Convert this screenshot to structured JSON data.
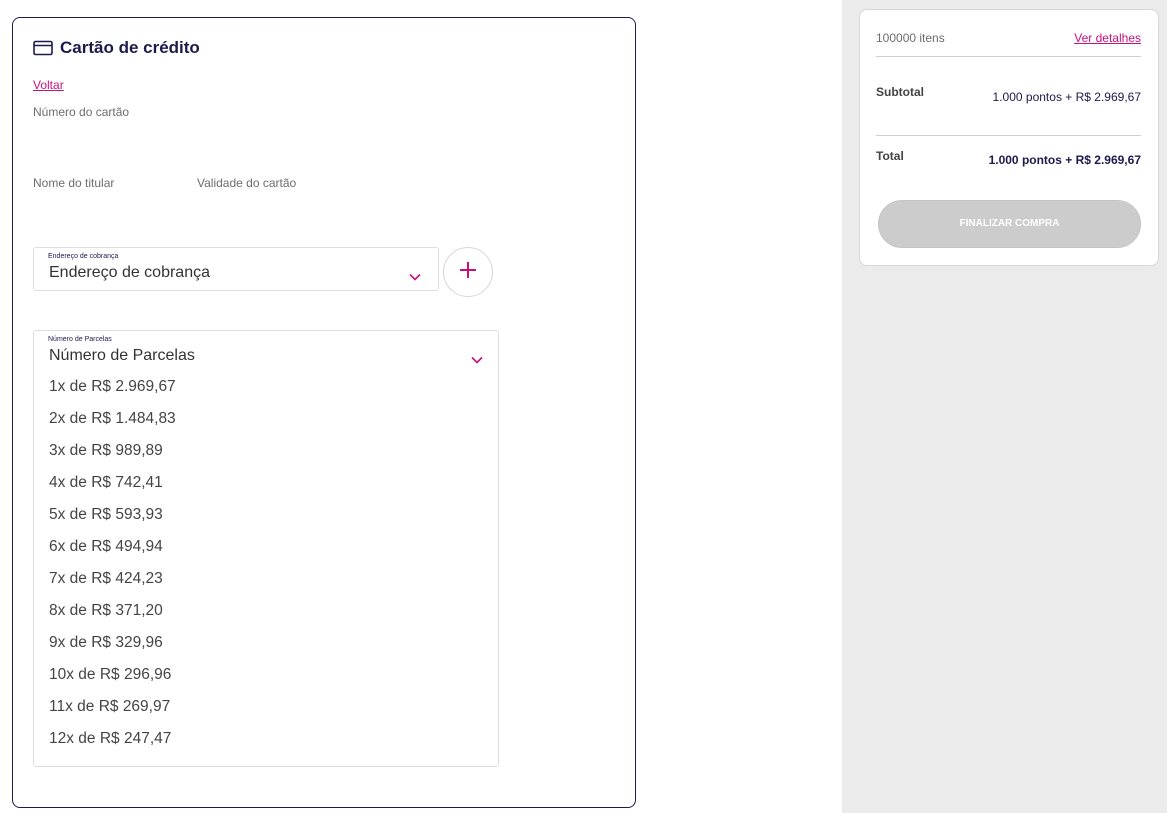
{
  "payment": {
    "title": "Cartão de crédito",
    "back_label": "Voltar",
    "card_number_label": "Número do cartão",
    "holder_name_label": "Nome do titular",
    "validity_label": "Validade do cartão"
  },
  "billing_address": {
    "small_label": "Endereço de cobrança",
    "value": "Endereço de cobrança"
  },
  "installments": {
    "small_label": "Número de Parcelas",
    "value": "Número de Parcelas",
    "options": [
      "1x de R$ 2.969,67",
      "2x de R$ 1.484,83",
      "3x de R$ 989,89",
      "4x de R$ 742,41",
      "5x de R$ 593,93",
      "6x de R$ 494,94",
      "7x de R$ 424,23",
      "8x de R$ 371,20",
      "9x de R$ 329,96",
      "10x de R$ 296,96",
      "11x de R$ 269,97",
      "12x de R$ 247,47"
    ]
  },
  "summary": {
    "items_count": "100000 itens",
    "details_label": "Ver detalhes",
    "subtotal_label": "Subtotal",
    "subtotal_value": "1.000 pontos + R$ 2.969,67",
    "total_label": "Total",
    "total_value": "1.000 pontos + R$ 2.969,67",
    "finish_label": "FINALIZAR COMPRA"
  },
  "colors": {
    "accent": "#c4107f",
    "navy": "#1d1a4e",
    "disabled": "#cccccc",
    "sidebar_bg": "#ebebeb"
  },
  "icons": {
    "card": "credit-card-icon",
    "chevron": "chevron-down-icon",
    "add": "plus-icon"
  }
}
